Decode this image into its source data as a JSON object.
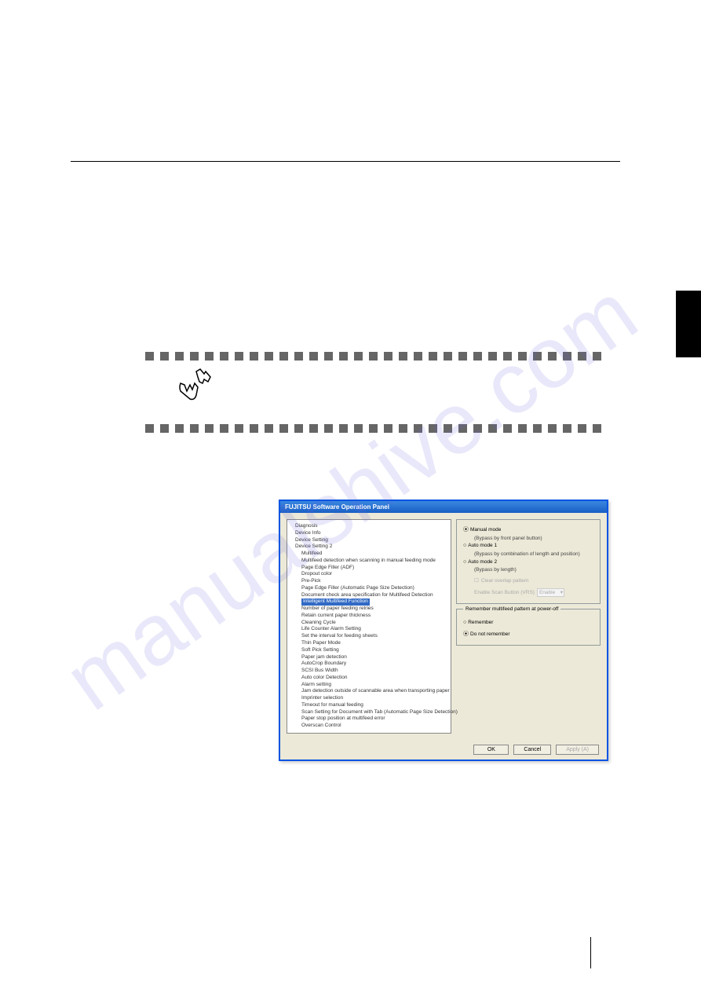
{
  "watermark": "manualshive.com",
  "dialog": {
    "title": "FUJITSU Software Operation Panel",
    "tree": {
      "items": [
        "Diagnosis",
        "Device Info",
        "Device Setting",
        "Device Setting 2"
      ],
      "children2": [
        "Multifeed",
        "Multifeed detection when scanning in manual feeding mode",
        "Page Edge Filler (ADF)",
        "Dropout color",
        "Pre-Pick",
        "Page Edge Filler (Automatic Page Size Detection)",
        "Document check area specification for Multifeed Detection",
        "Intelligent Multifeed Function",
        "Number of paper feeding retries",
        "Retain current paper thickness",
        "Cleaning Cycle",
        "Life Counter Alarm Setting",
        "Set the interval for feeding sheets",
        "Thin Paper Mode",
        "Soft Pick Setting",
        "Paper jam detection",
        "AutoCrop Boundary",
        "SCSI Bus Width",
        "Auto color Detection",
        "Alarm setting",
        "Jam detection outside of scannable area when transporting paper",
        "Imprinter selection",
        "Timeout for manual feeding",
        "Scan Setting for Document with Tab (Automatic Page Size Detection)",
        "Paper stop position at multifeed error",
        "Overscan Control"
      ]
    },
    "modes": {
      "manual": "Manual mode",
      "manual_sub": "(Bypass by front panel button)",
      "auto1": "Auto mode 1",
      "auto1_sub": "(Bypass by combination of length and position)",
      "auto2": "Auto mode 2",
      "auto2_sub": "(Bypass by length)",
      "clear_label": "Clear overlap pattern",
      "enable_label": "Enable Scan Button (VRS)",
      "enable_value": "Enable"
    },
    "remember": {
      "legend": "Remember multifeed pattern at power-off",
      "opt1": "Remember",
      "opt2": "Do not remember"
    },
    "buttons": {
      "ok": "OK",
      "cancel": "Cancel",
      "apply": "Apply (A)"
    }
  }
}
